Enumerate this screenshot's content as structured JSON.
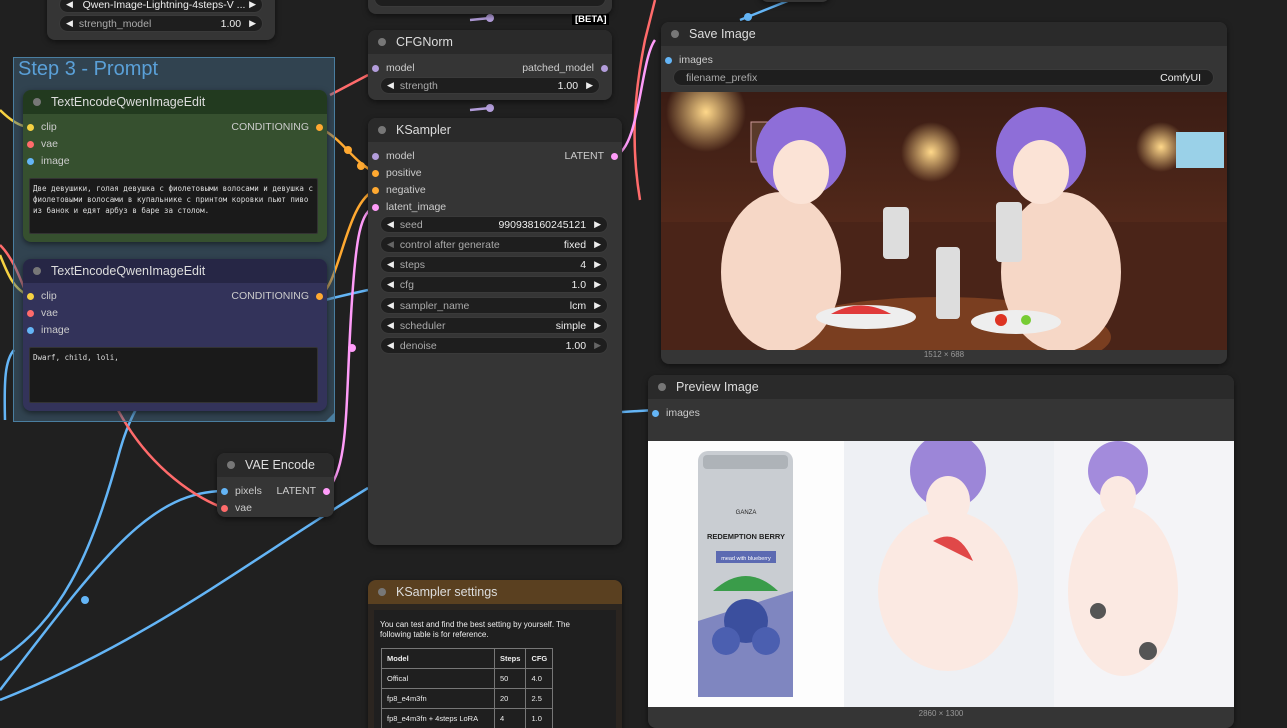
{
  "top_partial": {
    "lora_name": "Qwen-Image-Lightning-4steps-V ...",
    "strength_model_label": "strength_model",
    "strength_model_value": "1.00",
    "beta_badge": "[BETA]"
  },
  "group": {
    "title": "Step 3 - Prompt"
  },
  "text_encode_1": {
    "title": "TextEncodeQwenImageEdit",
    "inputs": [
      "clip",
      "vae",
      "image"
    ],
    "output": "CONDITIONING",
    "prompt": "Две девушики, голая девушка с фиолетовыми волосами и девушка с фиолетовыми волосами в купальнике с принтом коровки пьют пиво из банок и едят арбуз в баре за столом."
  },
  "text_encode_2": {
    "title": "TextEncodeQwenImageEdit",
    "inputs": [
      "clip",
      "vae",
      "image"
    ],
    "output": "CONDITIONING",
    "prompt": "Dwarf, child, loli,"
  },
  "vae_encode": {
    "title": "VAE Encode",
    "inputs": [
      "pixels",
      "vae"
    ],
    "output": "LATENT"
  },
  "cfgnorm": {
    "title": "CFGNorm",
    "input": "model",
    "output": "patched_model",
    "strength_label": "strength",
    "strength_value": "1.00"
  },
  "ksampler": {
    "title": "KSampler",
    "inputs": [
      "model",
      "positive",
      "negative",
      "latent_image"
    ],
    "output": "LATENT",
    "widgets": [
      {
        "label": "seed",
        "value": "990938160245121"
      },
      {
        "label": "control after generate",
        "value": "fixed"
      },
      {
        "label": "steps",
        "value": "4"
      },
      {
        "label": "cfg",
        "value": "1.0"
      },
      {
        "label": "sampler_name",
        "value": "lcm"
      },
      {
        "label": "scheduler",
        "value": "simple"
      },
      {
        "label": "denoise",
        "value": "1.00"
      }
    ]
  },
  "ksampler_settings": {
    "title": "KSampler settings",
    "description": "You can test and find the best setting by yourself. The following table is for reference.",
    "headers": [
      "Model",
      "Steps",
      "CFG"
    ],
    "rows": [
      [
        "Offical",
        "50",
        "4.0"
      ],
      [
        "fp8_e4m3fn",
        "20",
        "2.5"
      ],
      [
        "fp8_e4m3fn + 4steps LoRA",
        "4",
        "1.0"
      ]
    ]
  },
  "save_image": {
    "title": "Save Image",
    "input": "images",
    "prefix_label": "filename_prefix",
    "prefix_value": "ComfyUI",
    "dimensions": "1512 × 688"
  },
  "preview_image": {
    "title": "Preview Image",
    "input": "images",
    "dimensions": "2860 × 1300",
    "can_brand": "GANZA",
    "can_title": "REDEMPTION BERRY",
    "can_subtitle": "mead with blueberry"
  },
  "colors": {
    "clip": "#f5d142",
    "vae": "#ff6b6b",
    "image": "#64b5f6",
    "conditioning": "#ffa931",
    "model": "#b39ddb",
    "latent": "#ff9cf9",
    "group_title": "#5aa0d8"
  }
}
